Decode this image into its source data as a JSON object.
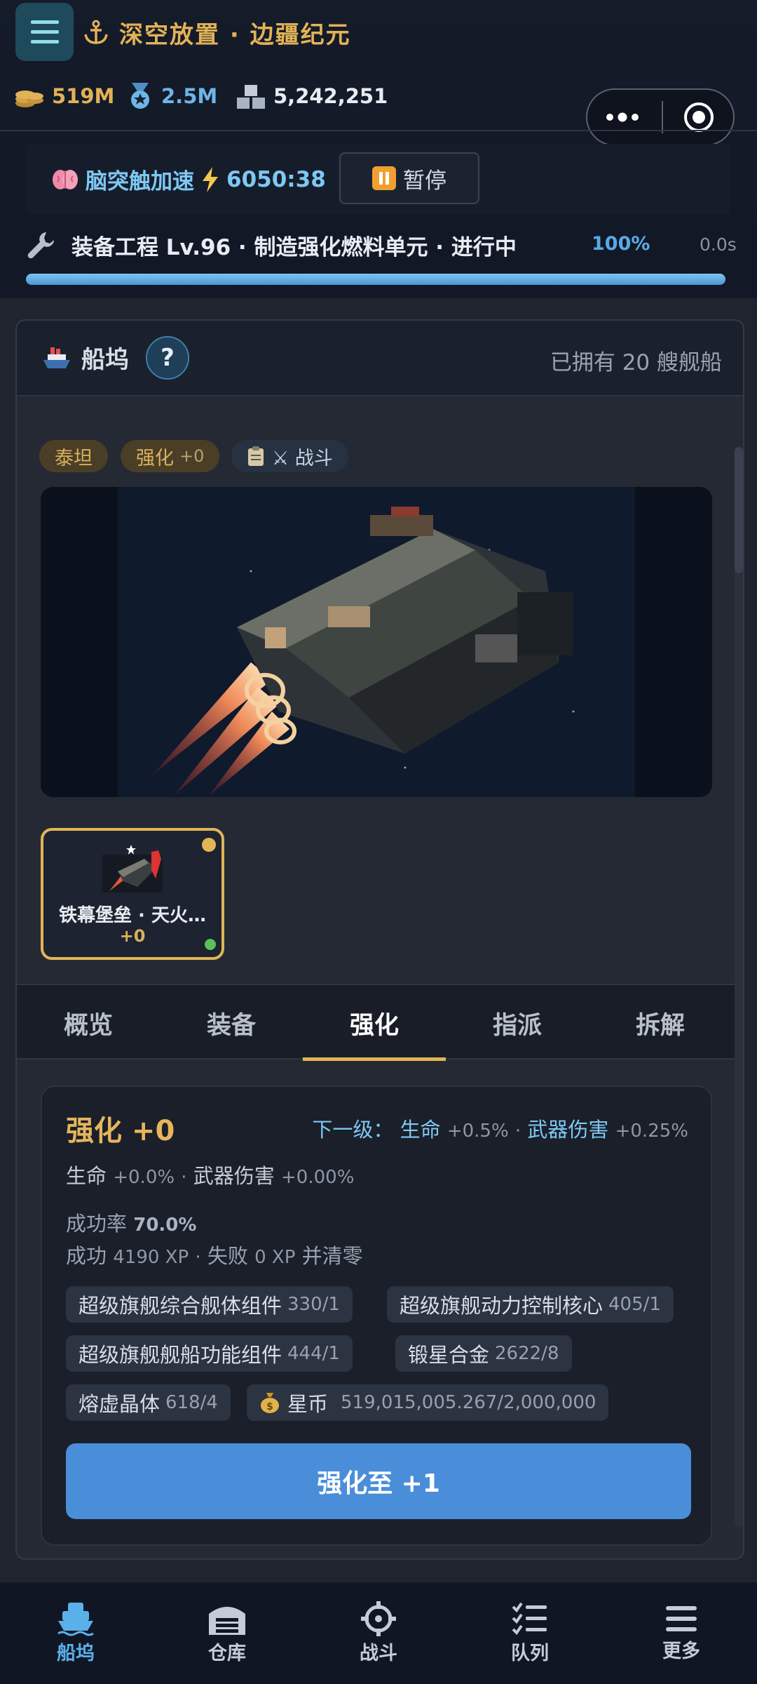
{
  "colors": {
    "accent": "#e0b556",
    "primary": "#4a8ed9",
    "link": "#7ec8f4",
    "background": "#20242e"
  },
  "header": {
    "title": "深空放置 · 边疆纪元",
    "title_icon": "anchor-icon",
    "menu_icon": "hamburger-menu-icon",
    "resources": [
      {
        "icon": "coins-icon",
        "value": "519M",
        "color": "#e2b257"
      },
      {
        "icon": "medal-icon",
        "value": "2.5M",
        "color": "#6fb4e8"
      },
      {
        "icon": "blocks-icon",
        "value": "5,242,251",
        "color": "#e8ecf2"
      }
    ],
    "capsule": {
      "more_icon": "more-dots-icon",
      "close_icon": "target-circle-icon"
    }
  },
  "boost": {
    "label": "脑突触加速",
    "time": "6050:38",
    "pause_label": "暂停"
  },
  "task": {
    "text": "装备工程 Lv.96 · 制造强化燃料单元 · 进行中",
    "percent": "100%",
    "progress": 1.0,
    "time": "0.0s"
  },
  "dock": {
    "title": "船坞",
    "help_label": "?",
    "owned_text": "已拥有 20 艘舰船",
    "tags": [
      {
        "label": "泰坦"
      },
      {
        "label": "强化",
        "value": "+0"
      },
      {
        "label": "⚔ 战斗"
      }
    ],
    "ship_card": {
      "name": "铁幕堡垒 · 天火…",
      "level": "+0"
    },
    "tabs": [
      "概览",
      "装备",
      "强化",
      "指派",
      "拆解"
    ],
    "active_tab": 2
  },
  "enhance": {
    "title": "强化 +0",
    "next_prefix": "下一级：",
    "next_hp_label": "生命",
    "next_hp_value": "+0.5%",
    "next_dmg_label": "武器伤害",
    "next_dmg_value": "+0.25%",
    "cur_hp_label": "生命",
    "cur_hp_value": "+0.0%",
    "cur_dmg_label": "武器伤害",
    "cur_dmg_value": "+0.00%",
    "rate_label": "成功率",
    "rate_value": "70.0%",
    "success_label": "成功",
    "success_value": "4190 XP",
    "fail_label": "失败",
    "fail_value": "0 XP",
    "fail_suffix": "并清零",
    "materials": [
      {
        "name": "超级旗舰综合舰体组件",
        "qty": "330/1"
      },
      {
        "name": "超级旗舰动力控制核心",
        "qty": "405/1"
      },
      {
        "name": "超级旗舰舰船功能组件",
        "qty": "444/1"
      },
      {
        "name": "锻星合金",
        "qty": "2622/8"
      },
      {
        "name": "熔虚晶体",
        "qty": "618/4"
      },
      {
        "name": "星币",
        "qty": "519,015,005.267/2,000,000",
        "icon": "money-bag-icon"
      }
    ],
    "button_label": "强化至 +1"
  },
  "nav": [
    {
      "label": "船坞",
      "icon": "ship-icon",
      "active": true
    },
    {
      "label": "仓库",
      "icon": "warehouse-icon",
      "active": false
    },
    {
      "label": "战斗",
      "icon": "crosshair-icon",
      "active": false
    },
    {
      "label": "队列",
      "icon": "checklist-icon",
      "active": false
    },
    {
      "label": "更多",
      "icon": "hamburger-menu-icon",
      "active": false
    }
  ]
}
